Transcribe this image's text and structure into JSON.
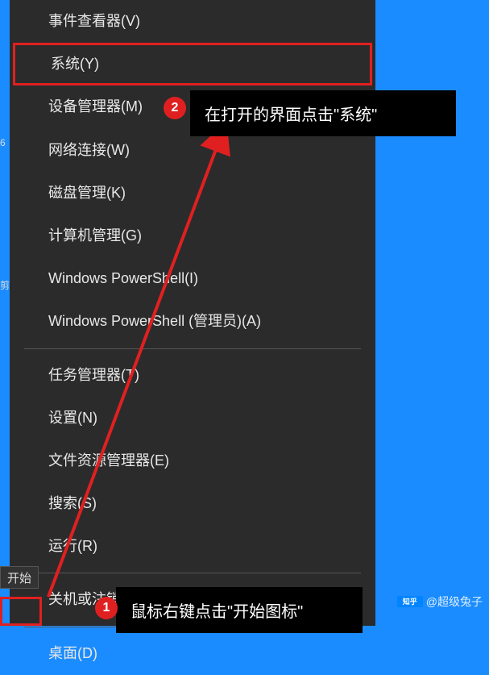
{
  "menu": {
    "items": [
      {
        "label": "事件查看器(V)"
      },
      {
        "label": "系统(Y)",
        "highlighted": true
      },
      {
        "label": "设备管理器(M)"
      },
      {
        "label": "网络连接(W)"
      },
      {
        "label": "磁盘管理(K)"
      },
      {
        "label": "计算机管理(G)"
      },
      {
        "label": "Windows PowerShell(I)"
      },
      {
        "label": "Windows PowerShell (管理员)(A)"
      },
      {
        "label": "任务管理器(T)"
      },
      {
        "label": "设置(N)"
      },
      {
        "label": "文件资源管理器(E)"
      },
      {
        "label": "搜索(S)"
      },
      {
        "label": "运行(R)"
      },
      {
        "label": "关机或注销(U)",
        "submenu": true
      },
      {
        "label": "桌面(D)"
      }
    ]
  },
  "annotations": {
    "badge1": "1",
    "badge2": "2",
    "tooltip1": "鼠标右键点击\"开始图标\"",
    "tooltip2": "在打开的界面点击\"系统\""
  },
  "taskbar": {
    "start": "开始"
  },
  "left_icons": {
    "num": "6",
    "char": "剪"
  },
  "watermark": {
    "logo_text": "知乎",
    "user": "@超级兔子"
  }
}
